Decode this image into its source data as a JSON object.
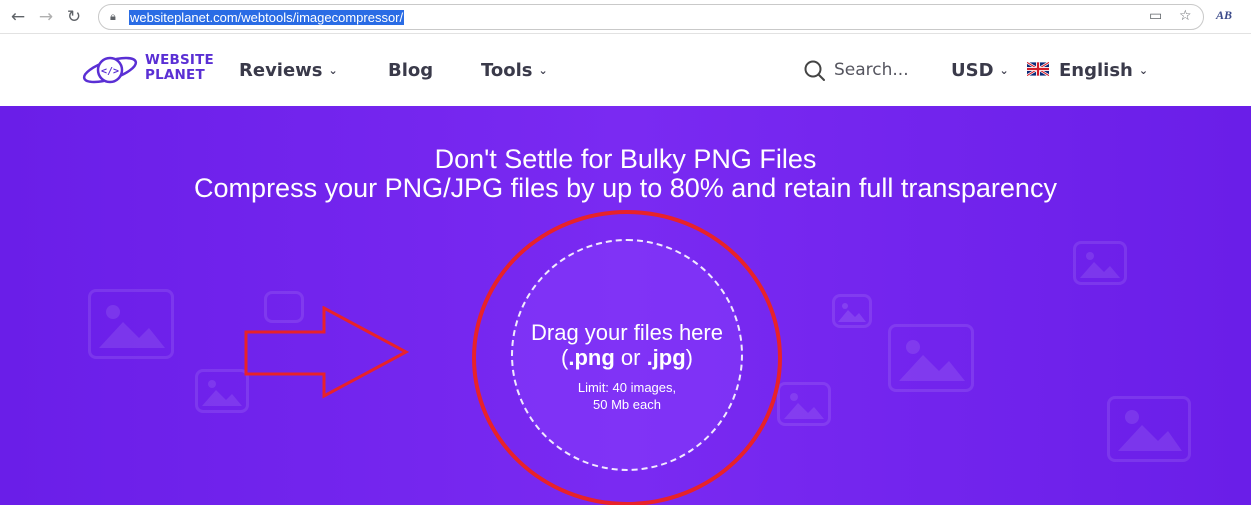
{
  "browser": {
    "url": "websiteplanet.com/webtools/imagecompressor/",
    "profile_initials": "AB",
    "icons": [
      "back-arrow-icon",
      "forward-arrow-icon",
      "reload-icon",
      "lock-icon",
      "cast-icon",
      "star-icon"
    ]
  },
  "header": {
    "logo_line1": "WEBSITE",
    "logo_line2": "PLANET",
    "nav": {
      "reviews": "Reviews",
      "blog": "Blog",
      "tools": "Tools"
    },
    "search_placeholder": "Search...",
    "currency": "USD",
    "language": "English"
  },
  "hero": {
    "title": "Don't Settle for Bulky PNG Files",
    "subtitle": "Compress your PNG/JPG files by up to 80% and retain full transparency",
    "drop_zone": {
      "line1": "Drag your files here",
      "open_paren": "(",
      "png": ".png",
      "or": " or ",
      "jpg": ".jpg",
      "close_paren": ")",
      "limit_line1": "Limit: 40 images,",
      "limit_line2": "50 Mb each"
    }
  },
  "colors": {
    "hero_bg": "#7328ee",
    "annotation_red": "#e8222a",
    "brand_purple": "#5a2fd4"
  }
}
